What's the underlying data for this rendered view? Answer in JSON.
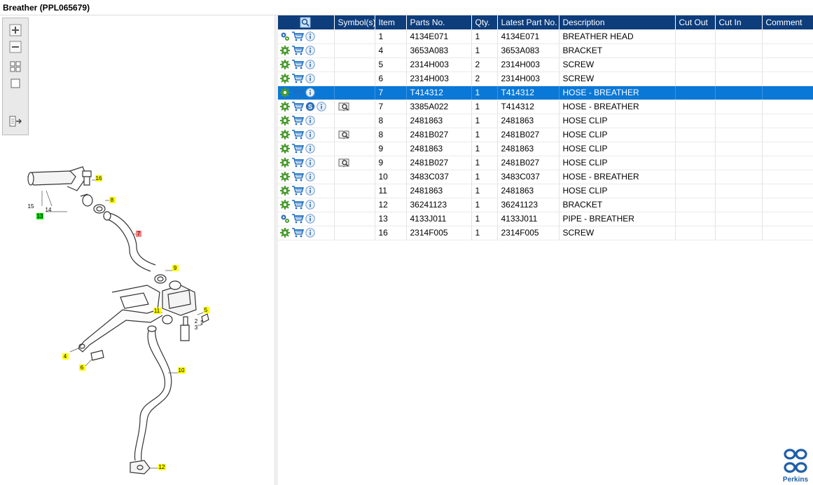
{
  "window": {
    "title": "Breather (PPL065679)"
  },
  "toolbar": {
    "buttons": [
      {
        "icon": "zoom-in-icon"
      },
      {
        "icon": "zoom-out-icon"
      },
      {
        "icon": "fit-all-icon"
      },
      {
        "icon": "actual-size-icon"
      },
      {
        "icon": "export-icon"
      }
    ]
  },
  "diagram": {
    "callouts": [
      {
        "label": "16",
        "color": "#ffff00"
      },
      {
        "label": "15",
        "color": "none"
      },
      {
        "label": "14",
        "color": "none"
      },
      {
        "label": "13",
        "color": "#00e000"
      },
      {
        "label": "8",
        "color": "#ffff00"
      },
      {
        "label": "7",
        "color": "#ff8080"
      },
      {
        "label": "9",
        "color": "#ffff00"
      },
      {
        "label": "5",
        "color": "#ffff00"
      },
      {
        "label": "11",
        "color": "#ffff00"
      },
      {
        "label": "1",
        "color": "none"
      },
      {
        "label": "2",
        "color": "none"
      },
      {
        "label": "3",
        "color": "none"
      },
      {
        "label": "4",
        "color": "#ffff00"
      },
      {
        "label": "6",
        "color": "#ffff00"
      },
      {
        "label": "10",
        "color": "#ffff00"
      },
      {
        "label": "12",
        "color": "#ffff00"
      }
    ]
  },
  "table": {
    "columns": [
      "",
      "Symbol(s)",
      "Item",
      "Parts No.",
      "Qty.",
      "Latest Part No.",
      "Description",
      "Cut Out",
      "Cut In",
      "Comment"
    ],
    "selected_row_color": "#0a78d7",
    "header_color": "#0d3d7b",
    "rows": [
      {
        "icons": [
          "gears-icon",
          "cart-icon",
          "info-icon"
        ],
        "symbol": "",
        "item": "1",
        "part_no": "4134E071",
        "qty": "1",
        "latest": "4134E071",
        "desc": "BREATHER HEAD",
        "cut_out": "",
        "cut_in": "",
        "comment": ""
      },
      {
        "icons": [
          "gear-icon",
          "cart-icon",
          "info-icon"
        ],
        "symbol": "",
        "item": "4",
        "part_no": "3653A083",
        "qty": "1",
        "latest": "3653A083",
        "desc": "BRACKET",
        "cut_out": "",
        "cut_in": "",
        "comment": ""
      },
      {
        "icons": [
          "gear-icon",
          "cart-icon",
          "info-icon"
        ],
        "symbol": "",
        "item": "5",
        "part_no": "2314H003",
        "qty": "2",
        "latest": "2314H003",
        "desc": "SCREW",
        "cut_out": "",
        "cut_in": "",
        "comment": ""
      },
      {
        "icons": [
          "gear-icon",
          "cart-icon",
          "info-icon"
        ],
        "symbol": "",
        "item": "6",
        "part_no": "2314H003",
        "qty": "2",
        "latest": "2314H003",
        "desc": "SCREW",
        "cut_out": "",
        "cut_in": "",
        "comment": ""
      },
      {
        "icons": [
          "gear-icon",
          "cart-icon",
          "info-icon"
        ],
        "symbol": "",
        "item": "7",
        "part_no": "T414312",
        "qty": "1",
        "latest": "T414312",
        "desc": "HOSE - BREATHER",
        "cut_out": "",
        "cut_in": "",
        "comment": "",
        "selected": true
      },
      {
        "icons": [
          "gear-icon",
          "cart-icon",
          "superseded-icon",
          "info-icon"
        ],
        "symbol": "book-search-icon",
        "item": "7",
        "part_no": "3385A022",
        "qty": "1",
        "latest": "T414312",
        "desc": "HOSE - BREATHER",
        "cut_out": "",
        "cut_in": "",
        "comment": ""
      },
      {
        "icons": [
          "gear-icon",
          "cart-icon",
          "info-icon"
        ],
        "symbol": "",
        "item": "8",
        "part_no": "2481863",
        "qty": "1",
        "latest": "2481863",
        "desc": "HOSE CLIP",
        "cut_out": "",
        "cut_in": "",
        "comment": ""
      },
      {
        "icons": [
          "gear-icon",
          "cart-icon",
          "info-icon"
        ],
        "symbol": "book-search-icon",
        "item": "8",
        "part_no": "2481B027",
        "qty": "1",
        "latest": "2481B027",
        "desc": "HOSE CLIP",
        "cut_out": "",
        "cut_in": "",
        "comment": ""
      },
      {
        "icons": [
          "gear-icon",
          "cart-icon",
          "info-icon"
        ],
        "symbol": "",
        "item": "9",
        "part_no": "2481863",
        "qty": "1",
        "latest": "2481863",
        "desc": "HOSE CLIP",
        "cut_out": "",
        "cut_in": "",
        "comment": ""
      },
      {
        "icons": [
          "gear-icon",
          "cart-icon",
          "info-icon"
        ],
        "symbol": "book-search-icon",
        "item": "9",
        "part_no": "2481B027",
        "qty": "1",
        "latest": "2481B027",
        "desc": "HOSE CLIP",
        "cut_out": "",
        "cut_in": "",
        "comment": ""
      },
      {
        "icons": [
          "gear-icon",
          "cart-icon",
          "info-icon"
        ],
        "symbol": "",
        "item": "10",
        "part_no": "3483C037",
        "qty": "1",
        "latest": "3483C037",
        "desc": "HOSE - BREATHER",
        "cut_out": "",
        "cut_in": "",
        "comment": ""
      },
      {
        "icons": [
          "gear-icon",
          "cart-icon",
          "info-icon"
        ],
        "symbol": "",
        "item": "11",
        "part_no": "2481863",
        "qty": "1",
        "latest": "2481863",
        "desc": "HOSE CLIP",
        "cut_out": "",
        "cut_in": "",
        "comment": ""
      },
      {
        "icons": [
          "gear-icon",
          "cart-icon",
          "info-icon"
        ],
        "symbol": "",
        "item": "12",
        "part_no": "36241123",
        "qty": "1",
        "latest": "36241123",
        "desc": "BRACKET",
        "cut_out": "",
        "cut_in": "",
        "comment": ""
      },
      {
        "icons": [
          "gears-icon",
          "cart-icon",
          "info-icon"
        ],
        "symbol": "",
        "item": "13",
        "part_no": "4133J011",
        "qty": "1",
        "latest": "4133J011",
        "desc": "PIPE - BREATHER",
        "cut_out": "",
        "cut_in": "",
        "comment": ""
      },
      {
        "icons": [
          "gear-icon",
          "cart-icon",
          "info-icon"
        ],
        "symbol": "",
        "item": "16",
        "part_no": "2314F005",
        "qty": "1",
        "latest": "2314F005",
        "desc": "SCREW",
        "cut_out": "",
        "cut_in": "",
        "comment": ""
      }
    ]
  },
  "logo": {
    "text": "Perkins",
    "icon": "perkins-logo-icon"
  }
}
